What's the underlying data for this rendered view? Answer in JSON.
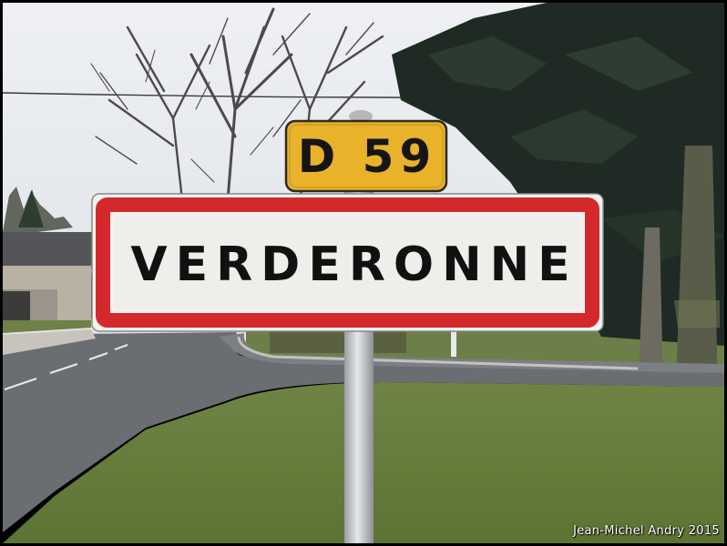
{
  "route_plate": {
    "text": "D 59"
  },
  "town_sign": {
    "text": "VERDERONNE"
  },
  "credit": {
    "text": "Jean-Michel Andry 2015"
  },
  "colors": {
    "route_plate_bg": "#e8b22b",
    "town_sign_border": "#d3292c",
    "town_sign_bg": "#f0eeea"
  }
}
